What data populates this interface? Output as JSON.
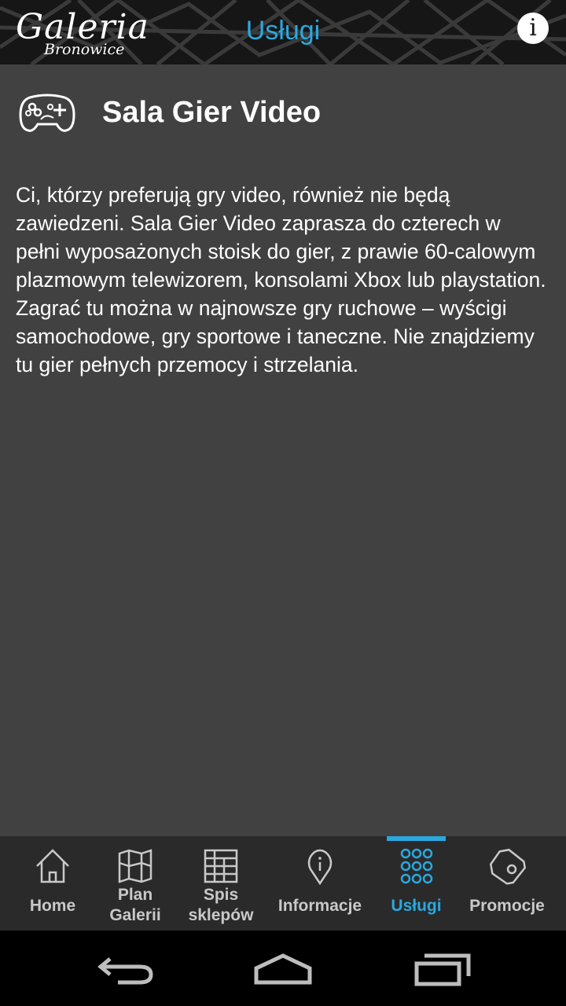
{
  "header": {
    "logo_line1": "Galeria",
    "logo_line2": "Bronowice",
    "title": "Usługi",
    "info_label": "i"
  },
  "service": {
    "icon": "gamepad-icon",
    "title": "Sala Gier Video",
    "description": "Ci, którzy preferują gry video, również nie będą zawiedzeni. Sala Gier Video zaprasza do czterech w pełni wyposażonych stoisk do gier, z prawie 60-calowym plazmowym telewizorem, konsolami Xbox lub playstation. Zagrać tu można w najnowsze gry ruchowe – wyścigi samochodowe, gry sportowe i taneczne. Nie znajdziemy tu gier pełnych przemocy i strzelania."
  },
  "tabs": [
    {
      "label_line1": "Home",
      "icon": "home-icon"
    },
    {
      "label_line1": "Plan",
      "label_line2": "Galerii",
      "icon": "map-icon"
    },
    {
      "label_line1": "Spis",
      "label_line2": "sklepów",
      "icon": "list-icon"
    },
    {
      "label_line1": "Informacje",
      "icon": "info-pin-icon"
    },
    {
      "label_line1": "Usługi",
      "icon": "grid-icon",
      "active": true
    },
    {
      "label_line1": "Promocje",
      "icon": "tag-icon"
    }
  ],
  "colors": {
    "accent": "#29a9e0",
    "background": "#414141",
    "topbar": "#161616",
    "tabbar": "#2a2a2a"
  },
  "system_nav": [
    "back-icon",
    "home-button-icon",
    "recents-icon"
  ]
}
